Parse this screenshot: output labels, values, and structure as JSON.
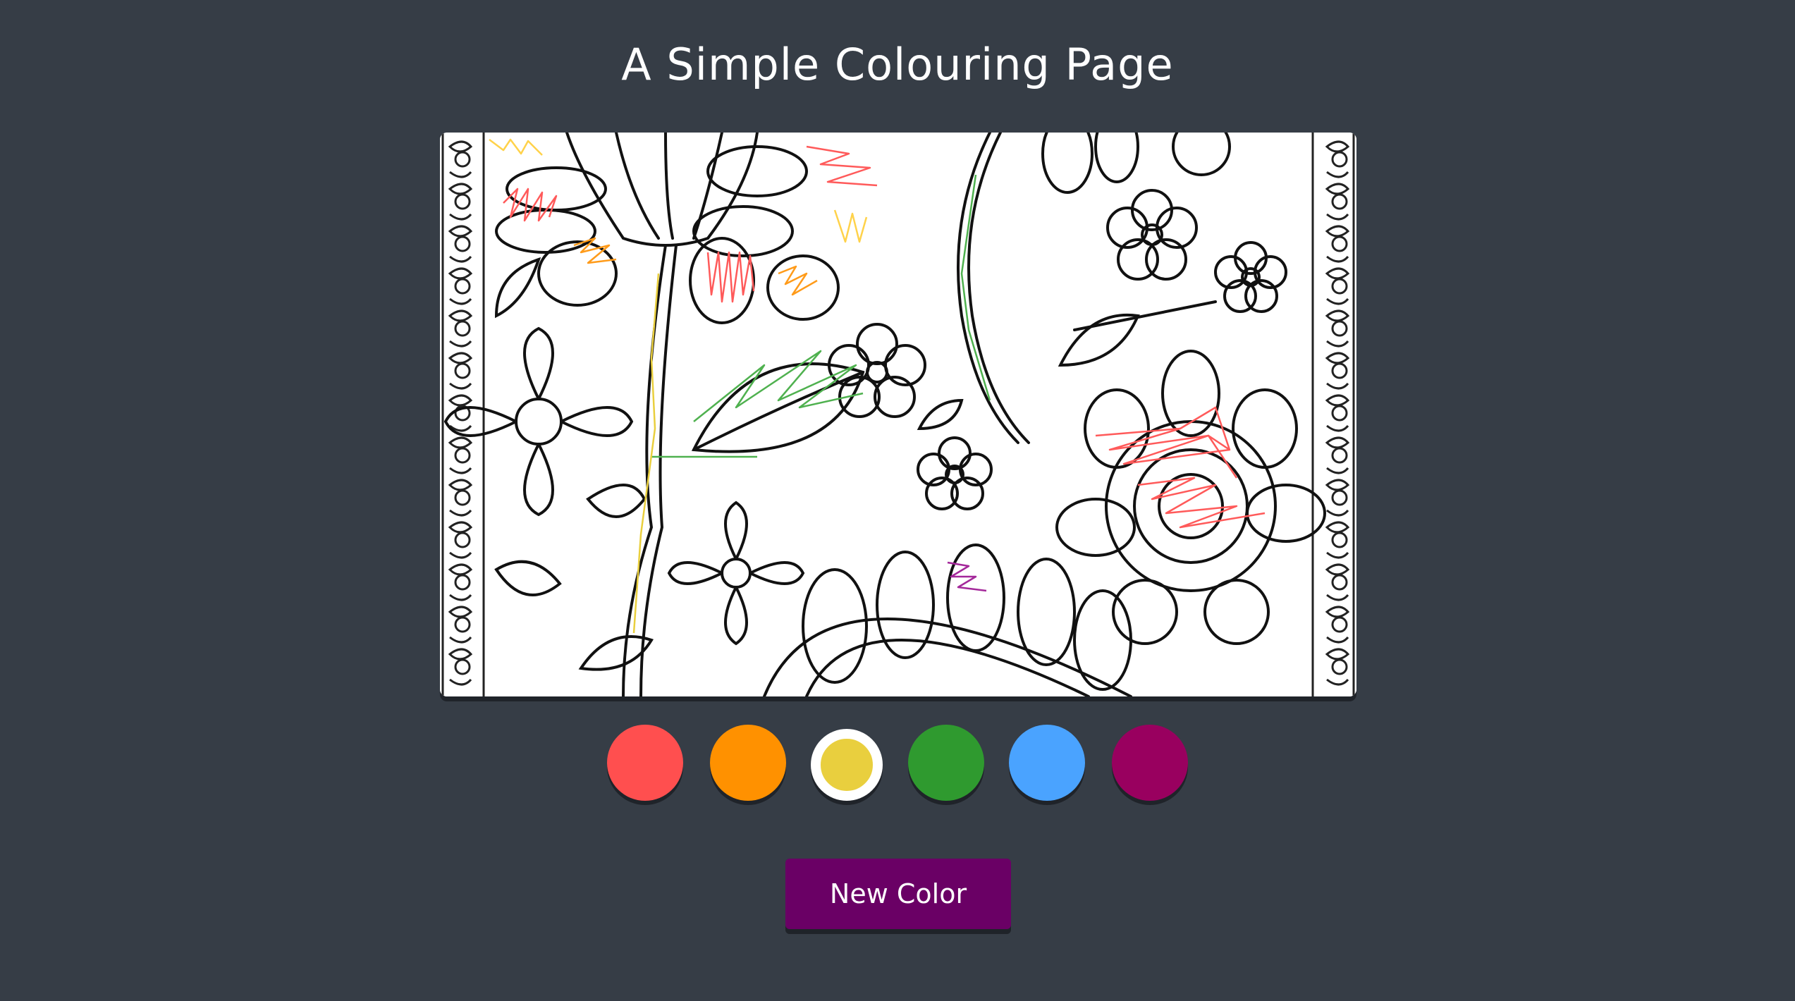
{
  "page": {
    "title": "A Simple Colouring Page"
  },
  "canvas": {
    "image_name": "floral-colouring-sheet"
  },
  "palette": {
    "colors": [
      {
        "name": "red",
        "hex": "#ff4f4f"
      },
      {
        "name": "orange",
        "hex": "#ff9100"
      },
      {
        "name": "yellow",
        "hex": "#e9cf3e"
      },
      {
        "name": "green",
        "hex": "#2f9a2f"
      },
      {
        "name": "blue",
        "hex": "#4aa3ff"
      },
      {
        "name": "purple",
        "hex": "#99005f"
      }
    ],
    "selected": "yellow"
  },
  "actions": {
    "new_color_label": "New Color",
    "button_color": "#6a0065"
  },
  "theme": {
    "background": "#363d46"
  }
}
